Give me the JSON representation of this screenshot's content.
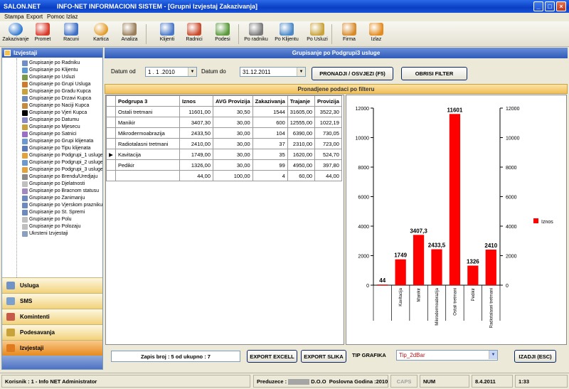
{
  "window": {
    "app_name": "SALON.NET",
    "title": "INFO-NET INFORMACIONI SISTEM - [Grupni Izvjestaj Zakazivanja]"
  },
  "menu": [
    "Stampa",
    "Export",
    "Pomoc",
    "Izlaz"
  ],
  "toolbar": [
    {
      "label": "Zakazivanje",
      "icon": "globe-calendar-icon"
    },
    {
      "label": "Promet",
      "icon": "bar-chart-icon"
    },
    {
      "label": "Racuni",
      "icon": "network-icon"
    },
    {
      "label": "Kartica",
      "icon": "globe-card-icon"
    },
    {
      "label": "Analiza",
      "icon": "magnifier-icon"
    },
    {
      "label": "Klijenti",
      "icon": "list-icon"
    },
    {
      "label": "Radnici",
      "icon": "id-card-icon"
    },
    {
      "label": "Podesi",
      "icon": "settings-icon"
    },
    {
      "label": "Po radniku",
      "icon": "report-worker-icon"
    },
    {
      "label": "Po Klijentu",
      "icon": "report-client-icon"
    },
    {
      "label": "Po Usluzi",
      "icon": "certificate-icon"
    },
    {
      "label": "Firma",
      "icon": "company-icon"
    },
    {
      "label": "Izlaz",
      "icon": "exit-arrow-icon"
    }
  ],
  "left_panel": {
    "header": "Izvjestaji",
    "items": [
      "Grupisanje po Radniku",
      "Grupisanje po Klijentu",
      "Grupisanje po Usluzi",
      "Grupisanje po Grupi Usluga",
      "Grupisanje po Gradu Kupca",
      "Grupisanje po Drzavi Kupca",
      "Grupisanje po Naciji Kupca",
      "Grupisanje po Vjeri Kupca",
      "Grupisanje po Datumu",
      "Grupisanje po Mjesecu",
      "Grupisanje po Satnici",
      "Grupisanje po Grupi klijenata",
      "Grupisanje po Tipu klijenata",
      "Grupisanje po Podgrupi_1 usluge",
      "Grupisanje po Podgrupi_2 usluge",
      "Grupisanje po Podgrupi_3 usluge",
      "Grupisanje po Brendu/Uredjaju",
      "Grupisanje po Djelatnosti",
      "Grupisanje po Bracnom statusu",
      "Grupisanje po Zanimanju",
      "Grupisanje po Vjerskom prazniku",
      "Grupisanje po St. Spremi",
      "Grupisanje po Polu",
      "Grupisanje po Polozaju",
      "Ukrsteni Izvjestaji"
    ],
    "nav_buttons": [
      "Usluga",
      "SMS",
      "Komintenti",
      "Podesavanja",
      "Izvjestaji"
    ]
  },
  "main": {
    "header": "Grupisanje po Podgrupi3 usluge",
    "date_from_label": "Datum od",
    "date_from_value": "1 . 1 .2010",
    "date_to_label": "Datum do",
    "date_to_value": "31.12.2011",
    "btn_refresh": "PRONADJI / OSVJEZI (F5)",
    "btn_clear": "OBRISI FILTER",
    "found_header": "Pronadjene podaci po filteru"
  },
  "grid": {
    "columns": [
      "Podgrupa 3",
      "Iznos",
      "AVG Provizija",
      "Zakazivanja",
      "Trajanje",
      "Provizija"
    ],
    "rows": [
      [
        "Ostali tretmani",
        "11601,00",
        "30,50",
        "1544",
        "31605,00",
        "3522,30"
      ],
      [
        "Manikir",
        "3407,30",
        "30,00",
        "600",
        "12555,00",
        "1022,19"
      ],
      [
        "Mikrodermoabrazija",
        "2433,50",
        "30,00",
        "104",
        "6390,00",
        "730,05"
      ],
      [
        "Radiotalasni tretmani",
        "2410,00",
        "30,00",
        "37",
        "2310,00",
        "723,00"
      ],
      [
        "Kavitacija",
        "1749,00",
        "30,00",
        "35",
        "1620,00",
        "524,70"
      ],
      [
        "Pedikir",
        "1326,00",
        "30,00",
        "99",
        "4950,00",
        "397,80"
      ]
    ],
    "totals": [
      "",
      "44,00",
      "100,00",
      "4",
      "60,00",
      "44,00"
    ],
    "current_row_index": 4
  },
  "chart_data": {
    "type": "bar",
    "categories": [
      "",
      "Kavitacija",
      "Manikir",
      "Mikrodermoabrazija",
      "Ostali tretmani",
      "Pedikir",
      "Radiotalasni tretmani"
    ],
    "series": [
      {
        "name": "Iznos",
        "values": [
          44,
          1749,
          3407.3,
          2433.5,
          11601,
          1326,
          2410
        ]
      }
    ],
    "data_labels": [
      "44",
      "1749",
      "3407,3",
      "2433,5",
      "11601",
      "1326",
      "2410"
    ],
    "y_ticks": [
      "0",
      "2000",
      "4000",
      "6000",
      "8000",
      "10000",
      "12000"
    ],
    "ylim": [
      0,
      12000
    ],
    "color": "#FF0000",
    "legend_position": "right",
    "grid": false
  },
  "bottom": {
    "record_count": "Zapis broj : 5 od ukupno : 7",
    "btn_export_excel": "EXPORT EXCELL",
    "btn_export_image": "EXPORT SLIKA",
    "chart_type_label": "TIP GRAFIKA",
    "chart_type_value": "Tip_2dBar",
    "btn_back": "IZADJI (ESC)"
  },
  "status": {
    "user": "Korisnik : 1 - Info NET  Administrator",
    "company_prefix": "Preduzece :",
    "company_suffix": "D.O.O",
    "fiscal_year": "Poslovna Godina :2010",
    "caps": "CAPS",
    "num": "NUM",
    "date": "8.4.2011",
    "time": "1:33"
  }
}
